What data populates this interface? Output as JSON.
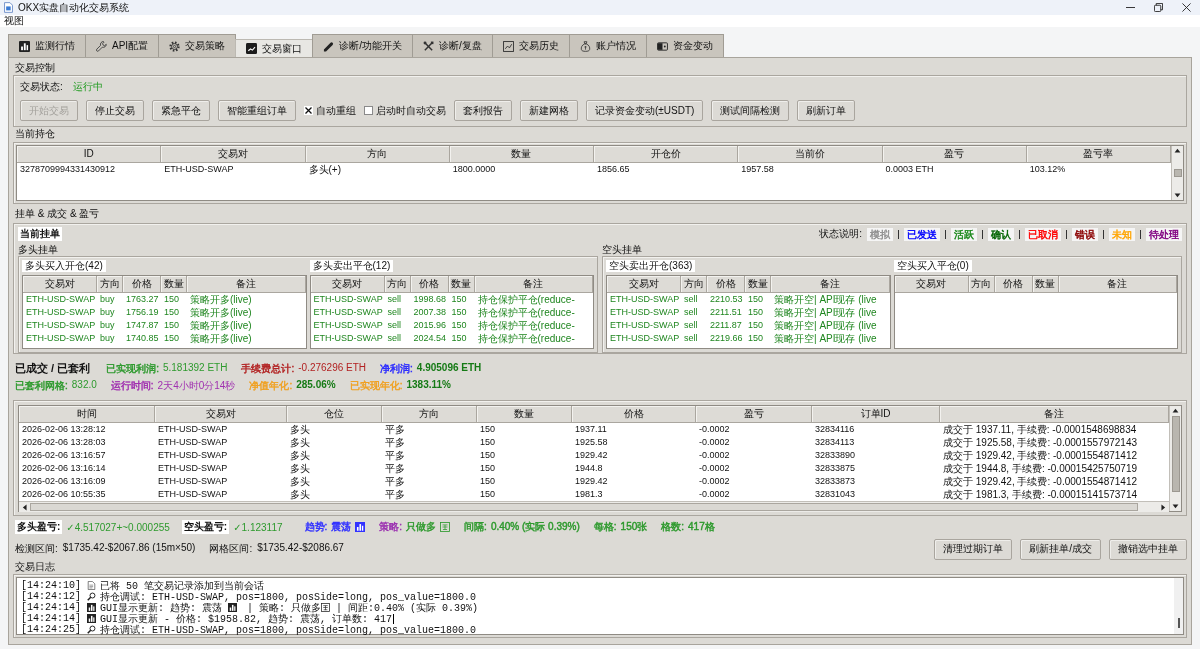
{
  "window": {
    "title": "OKX实盘自动化交易系统"
  },
  "menu": [
    "视图"
  ],
  "tabs": [
    {
      "label": "监测行情",
      "kind": "monitor",
      "selected": false
    },
    {
      "label": "API配置",
      "kind": "api",
      "selected": false
    },
    {
      "label": "交易策略",
      "kind": "strategy",
      "selected": false
    },
    {
      "label": "交易窗口",
      "kind": "trading",
      "selected": true
    },
    {
      "label": "诊断/功能开关",
      "kind": "switches",
      "selected": false
    },
    {
      "label": "诊断/复盘",
      "kind": "review",
      "selected": false
    },
    {
      "label": "交易历史",
      "kind": "history",
      "selected": false
    },
    {
      "label": "账户情况",
      "kind": "account",
      "selected": false
    },
    {
      "label": "资金变动",
      "kind": "funds",
      "selected": false
    }
  ],
  "control": {
    "title": "交易控制",
    "status_label": "交易状态:",
    "status_value": "运行中",
    "buttons": [
      {
        "label": "开始交易",
        "disabled": true
      },
      {
        "label": "停止交易",
        "disabled": false
      },
      {
        "label": "紧急平仓",
        "disabled": false
      },
      {
        "label": "智能重组订单",
        "disabled": false
      }
    ],
    "options": [
      {
        "label": "自动重组",
        "checked": true
      },
      {
        "label": "启动时自动交易",
        "checked": false
      }
    ],
    "more_buttons": [
      {
        "label": "套利报告",
        "disabled": false
      },
      {
        "label": "新建网格",
        "disabled": false
      },
      {
        "label": "记录资金变动(±USDT)",
        "disabled": false
      },
      {
        "label": "测试间隔检测",
        "disabled": false
      },
      {
        "label": "刷新订单",
        "disabled": false
      }
    ]
  },
  "positions": {
    "title": "当前持仓",
    "columns": [
      "ID",
      "交易对",
      "方向",
      "数量",
      "开仓价",
      "当前价",
      "盈亏",
      "盈亏率"
    ],
    "rows": [
      [
        "3278709994331430912",
        "ETH-USD-SWAP",
        "多头(+)",
        "1800.0000",
        "1856.65",
        "1957.58",
        "0.0003 ETH",
        "103.12%"
      ]
    ]
  },
  "orders": {
    "title": "挂单 & 成交 & 盈亏",
    "subtitle": "当前挂单",
    "legend": {
      "title": "状态说明:",
      "items": [
        {
          "label": "模拟",
          "color": "#909090"
        },
        {
          "label": "已发送",
          "color": "#0000ff"
        },
        {
          "label": "活跃",
          "color": "#1e8b1e"
        },
        {
          "label": "确认",
          "color": "#006400"
        },
        {
          "label": "已取消",
          "color": "#ff0000"
        },
        {
          "label": "错误",
          "color": "#8b0000"
        },
        {
          "label": "未知",
          "color": "#ffa500"
        },
        {
          "label": "待处理",
          "color": "#800080"
        }
      ]
    },
    "sides": [
      {
        "title": "多头挂单",
        "books": [
          {
            "title": "多头买入开仓(42)",
            "columns": [
              "交易对",
              "方向",
              "价格",
              "数量",
              "备注"
            ],
            "rows": [
              [
                "ETH-USD-SWAP",
                "buy",
                "1763.27",
                "150",
                "策略开多(live)"
              ],
              [
                "ETH-USD-SWAP",
                "buy",
                "1756.19",
                "150",
                "策略开多(live)"
              ],
              [
                "ETH-USD-SWAP",
                "buy",
                "1747.87",
                "150",
                "策略开多(live)"
              ],
              [
                "ETH-USD-SWAP",
                "buy",
                "1740.85",
                "150",
                "策略开多(live)"
              ]
            ]
          },
          {
            "title": "多头卖出平仓(12)",
            "columns": [
              "交易对",
              "方向",
              "价格",
              "数量",
              "备注"
            ],
            "rows": [
              [
                "ETH-USD-SWAP",
                "sell",
                "1998.68",
                "150",
                "持仓保护平仓(reduce-"
              ],
              [
                "ETH-USD-SWAP",
                "sell",
                "2007.38",
                "150",
                "持仓保护平仓(reduce-"
              ],
              [
                "ETH-USD-SWAP",
                "sell",
                "2015.96",
                "150",
                "持仓保护平仓(reduce-"
              ],
              [
                "ETH-USD-SWAP",
                "sell",
                "2024.54",
                "150",
                "持仓保护平仓(reduce-"
              ]
            ]
          }
        ]
      },
      {
        "title": "空头挂单",
        "books": [
          {
            "title": "空头卖出开仓(363)",
            "columns": [
              "交易对",
              "方向",
              "价格",
              "数量",
              "备注"
            ],
            "rows": [
              [
                "ETH-USD-SWAP",
                "sell",
                "2210.53",
                "150",
                "策略开空| API现存 (live"
              ],
              [
                "ETH-USD-SWAP",
                "sell",
                "2211.51",
                "150",
                "策略开空| API现存 (live"
              ],
              [
                "ETH-USD-SWAP",
                "sell",
                "2211.87",
                "150",
                "策略开空| API现存 (live"
              ],
              [
                "ETH-USD-SWAP",
                "sell",
                "2219.66",
                "150",
                "策略开空| API现存 (live"
              ]
            ]
          },
          {
            "title": "空头买入平仓(0)",
            "columns": [
              "交易对",
              "方向",
              "价格",
              "数量",
              "备注"
            ]
          }
        ]
      }
    ]
  },
  "filled": {
    "title": "已成交 / 已套利",
    "stats": [
      [
        {
          "label": "已实现利润:",
          "value": "5.181392 ETH",
          "color": "#2e9a2e",
          "highlight": false
        },
        {
          "label": "手续费总计:",
          "value": "-0.276296 ETH",
          "color": "#b22222",
          "highlight": false
        },
        {
          "label": "净利润:",
          "value": "4.905096 ETH",
          "color": "#2b2bff",
          "highlight": true
        }
      ],
      [
        {
          "label": "已套利网格:",
          "value": "832.0",
          "color": "#2e9a2e",
          "highlight": false
        },
        {
          "label": "运行时间:",
          "value": "2天4小时0分14秒",
          "color": "#a030b0",
          "highlight": false
        },
        {
          "label": "净值年化:",
          "value": "285.06%",
          "color": "#f0a020",
          "highlight": true
        },
        {
          "label": "已实现年化:",
          "value": "1383.11%",
          "color": "#f0a020",
          "highlight": true
        }
      ]
    ],
    "columns": [
      "时间",
      "交易对",
      "仓位",
      "方向",
      "数量",
      "价格",
      "盈亏",
      "订单ID",
      "备注"
    ],
    "rows": [
      [
        "2026-02-06 13:28:12",
        "ETH-USD-SWAP",
        "多头",
        "平多",
        "150",
        "1937.11",
        "-0.0002",
        "32834116",
        "成交于 1937.11, 手续费: -0.0001548698834"
      ],
      [
        "2026-02-06 13:28:03",
        "ETH-USD-SWAP",
        "多头",
        "平多",
        "150",
        "1925.58",
        "-0.0002",
        "32834113",
        "成交于 1925.58, 手续费: -0.0001557972143"
      ],
      [
        "2026-02-06 13:16:57",
        "ETH-USD-SWAP",
        "多头",
        "平多",
        "150",
        "1929.42",
        "-0.0002",
        "32833890",
        "成交于 1929.42, 手续费: -0.0001554871412"
      ],
      [
        "2026-02-06 13:16:14",
        "ETH-USD-SWAP",
        "多头",
        "平多",
        "150",
        "1944.8",
        "-0.0002",
        "32833875",
        "成交于 1944.8, 手续费: -0.00015425750719"
      ],
      [
        "2026-02-06 13:16:09",
        "ETH-USD-SWAP",
        "多头",
        "平多",
        "150",
        "1929.42",
        "-0.0002",
        "32833873",
        "成交于 1929.42, 手续费: -0.0001554871412"
      ],
      [
        "2026-02-06 10:55:35",
        "ETH-USD-SWAP",
        "多头",
        "平多",
        "150",
        "1981.3",
        "-0.0002",
        "32831043",
        "成交于 1981.3, 手续费: -0.00015141573714"
      ]
    ]
  },
  "summary": {
    "long": {
      "label": "多头盈亏:",
      "value": "✓4.517027+~0.000255"
    },
    "short": {
      "label": "空头盈亏:",
      "value": "✓1.123117"
    },
    "items": [
      {
        "kind": "trend",
        "label": {
          "text": "趋势:",
          "color": "#3232ff"
        },
        "value": {
          "text": "震荡",
          "color": "#3232ff"
        }
      },
      {
        "kind": "strategy",
        "label": {
          "text": "策略:",
          "color": "#9b30b0"
        },
        "value": {
          "text": "只做多",
          "color": "#2e9a2e"
        }
      },
      {
        "kind": "plain",
        "label": {
          "text": "间隔:",
          "color": "#2e9a2e"
        },
        "value": {
          "text": "0.40% (实际 0.39%)",
          "color": "#2e9a2e"
        }
      },
      {
        "kind": "plain",
        "label": {
          "text": "每格:",
          "color": "#2e9a2e"
        },
        "value": {
          "text": "150张",
          "color": "#2e9a2e"
        }
      },
      {
        "kind": "plain",
        "label": {
          "text": "格数:",
          "color": "#2e9a2e"
        },
        "value": {
          "text": "417格",
          "color": "#2e9a2e"
        }
      }
    ]
  },
  "ranges": [
    {
      "label": "检测区间:",
      "value": "$1735.42-$2067.86 (15m×50)"
    },
    {
      "label": "网格区间:",
      "value": "$1735.42-$2086.67"
    }
  ],
  "actions": [
    "清理过期订单",
    "刷新挂单/成交",
    "撤销选中挂单"
  ],
  "log": {
    "title": "交易日志",
    "lines": [
      {
        "time": "[14:24:10]",
        "kind": "session",
        "cursor": false,
        "parts": [
          {
            "kind": "text",
            "text": "已将 50 笔交易记录添加到当前会话"
          }
        ]
      },
      {
        "time": "[14:24:12]",
        "kind": "debug",
        "cursor": false,
        "parts": [
          {
            "kind": "text",
            "text": "持仓调试: ETH-USD-SWAP, pos=1800, posSide=long, pos_value=1800.0"
          }
        ]
      },
      {
        "time": "[14:24:14]",
        "kind": "gui",
        "cursor": false,
        "parts": [
          {
            "kind": "text",
            "text": "GUI显示更新: 趋势: 震荡"
          },
          {
            "kind": "trend_mark"
          },
          {
            "kind": "text",
            "text": " | 策略: 只做多"
          },
          {
            "kind": "strategy_mark"
          },
          {
            "kind": "text",
            "text": " | 间距:0.40% (实际 0.39%)"
          }
        ]
      },
      {
        "time": "[14:24:14]",
        "kind": "gui",
        "cursor": true,
        "parts": [
          {
            "kind": "text",
            "text": "GUI显示更新 - 价格: $1958.82, 趋势: 震荡, 订单数: 417"
          }
        ]
      },
      {
        "time": "[14:24:25]",
        "kind": "debug",
        "cursor": false,
        "parts": [
          {
            "kind": "text",
            "text": "持仓调试: ETH-USD-SWAP, pos=1800, posSide=long, pos_value=1800.0"
          }
        ]
      }
    ]
  }
}
